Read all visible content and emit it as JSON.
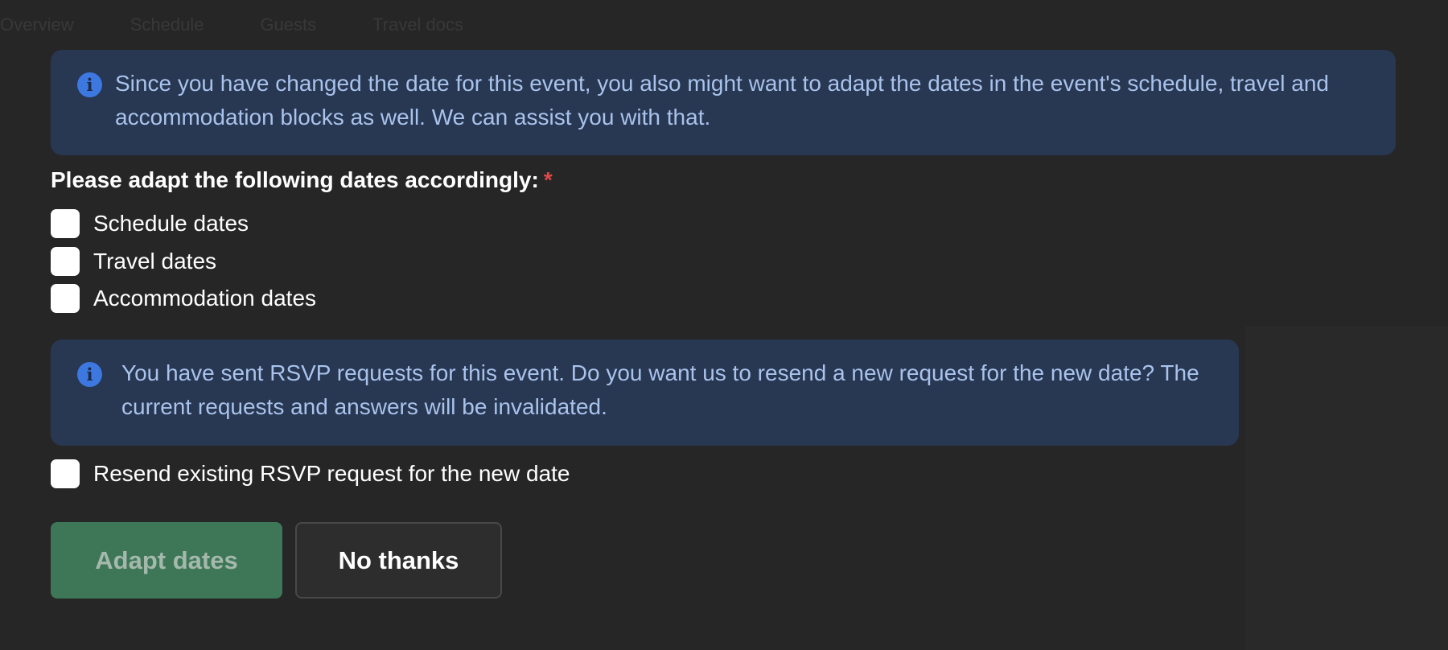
{
  "background_tabs": [
    "Overview",
    "Schedule",
    "Guests",
    "Travel docs"
  ],
  "alerts": {
    "date_change": "Since you have changed the date for this event, you also might want to adapt the dates in the event's schedule, travel and accommodation blocks as well. We can assist you with that.",
    "rsvp": "You have sent RSVP requests for this event. Do you want us to resend a new request for the new date? The current requests and answers will be invalidated."
  },
  "form": {
    "dates_label": "Please adapt the following dates accordingly:",
    "required_mark": "*",
    "options": {
      "schedule": "Schedule dates",
      "travel": "Travel dates",
      "accommodation": "Accommodation dates"
    },
    "resend_label": "Resend existing RSVP request for the new date"
  },
  "buttons": {
    "adapt": "Adapt dates",
    "no_thanks": "No thanks"
  },
  "colors": {
    "background": "#262626",
    "alert_bg": "#283752",
    "alert_text": "#a9c3ec",
    "info_icon": "#3d78e0",
    "primary_button": "#3e7758",
    "required": "#e04848"
  },
  "icons": {
    "alert": "info-icon"
  }
}
